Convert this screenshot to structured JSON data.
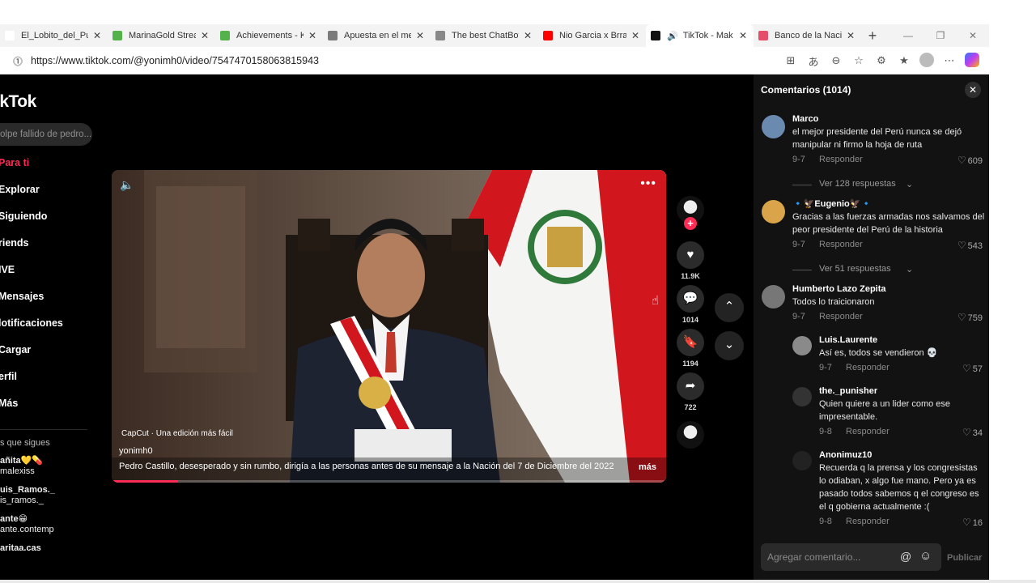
{
  "browser": {
    "tabs": [
      {
        "title": "El_Lobito_del_Pue",
        "color": "#ffffff"
      },
      {
        "title": "MarinaGold Strea",
        "color": "#53b34a"
      },
      {
        "title": "Achievements - Ki",
        "color": "#53b34a"
      },
      {
        "title": "Apuesta en el mej",
        "color": "#7b7b7b"
      },
      {
        "title": "The best ChatBot",
        "color": "#888888"
      },
      {
        "title": "Nio Garcia x Brray",
        "color": "#ff0000"
      },
      {
        "title": "TikTok - Mak",
        "color": "#111111"
      },
      {
        "title": "Banco de la Nació",
        "color": "#e84c6b"
      }
    ],
    "url": "https://www.tiktok.com/@yonimh0/video/7547470158063815943"
  },
  "sidebar": {
    "logo": "ikTok",
    "search_placeholder": "olpe fallido de pedro...",
    "nav": [
      "Para ti",
      "Explorar",
      "Siguiendo",
      "riends",
      "IVE",
      "Mensajes",
      "lotificaciones",
      "Cargar",
      "erfil",
      "Más"
    ],
    "following_header": "s que sigues",
    "following": [
      {
        "name": "añita💛💊",
        "handle": "malexiss"
      },
      {
        "name": "uis_Ramos._",
        "handle": "is_ramos._"
      },
      {
        "name": "ante😁",
        "handle": "ante.contemp"
      },
      {
        "name": "aritaa.cas",
        "handle": ""
      }
    ]
  },
  "video": {
    "capcut": "CapCut · Una edición más fácil",
    "user": "yonimh0",
    "description": "Pedro Castillo, desesperado y sin rumbo, dirigía a las personas antes de su mensaje a la Nación del 7 de Diciembre del 2022 ...",
    "more": "más",
    "progress_fraction": 0.12
  },
  "actions": {
    "likes": "11.9K",
    "comments": "1014",
    "saves": "1194",
    "shares": "722"
  },
  "comments_panel": {
    "title": "Comentarios (1014)",
    "reply_label": "Responder",
    "input_placeholder": "Agregar comentario...",
    "publish": "Publicar",
    "comments": [
      {
        "name": "Marco",
        "text": "el mejor presidente del Perú nunca se dejó manipular ni firmo la hoja de ruta",
        "date": "9-7",
        "likes": "609",
        "more": "Ver 128 respuestas",
        "reply": false
      },
      {
        "name": "🔹🦅Eugenio🦅🔹",
        "text": "Gracias a las fuerzas armadas nos salvamos del peor presidente del Perú de la historia",
        "date": "9-7",
        "likes": "543",
        "more": "Ver 51 respuestas",
        "reply": false
      },
      {
        "name": "Humberto Lazo Zepita",
        "text": "Todos lo traicionaron",
        "date": "9-7",
        "likes": "759",
        "more": "",
        "reply": false
      },
      {
        "name": "Luis.Laurente",
        "text": "Así es, todos se vendieron 💀",
        "date": "9-7",
        "likes": "57",
        "more": "",
        "reply": true
      },
      {
        "name": "the._punisher",
        "text": "Quien quiere a un lider como ese impresentable.",
        "date": "9-8",
        "likes": "34",
        "more": "",
        "reply": true
      },
      {
        "name": "Anonimuz10",
        "text": "Recuerda q la prensa y los congresistas lo odiaban, x algo fue mano. Pero ya es pasado todos sabemos q el congreso es el q gobierna actualmente :(",
        "date": "9-8",
        "likes": "16",
        "more": "",
        "reply": true
      }
    ]
  }
}
